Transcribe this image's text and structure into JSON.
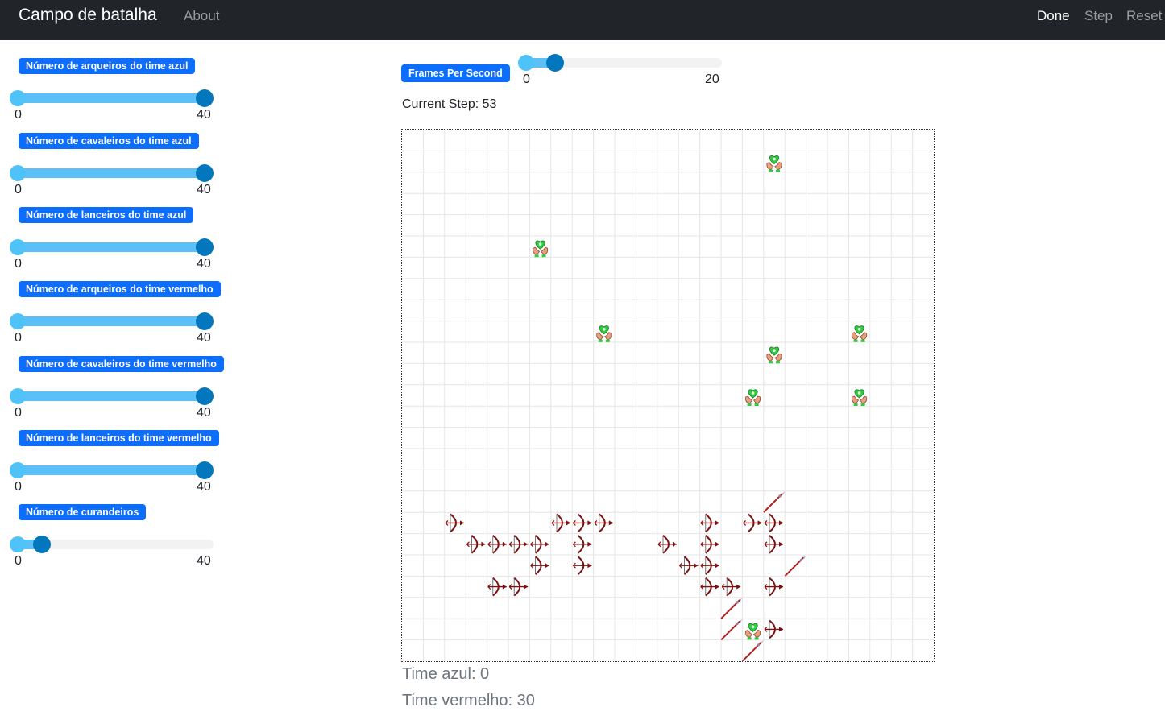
{
  "navbar": {
    "brand": "Campo de batalha",
    "about": "About",
    "done": "Done",
    "step": "Step",
    "reset": "Reset"
  },
  "params": [
    {
      "label": "Número de arqueiros do time azul",
      "min": "0",
      "max": "40",
      "value": 40
    },
    {
      "label": "Número de cavaleiros do time azul",
      "min": "0",
      "max": "40",
      "value": 40
    },
    {
      "label": "Número de lanceiros do time azul",
      "min": "0",
      "max": "40",
      "value": 40
    },
    {
      "label": "Número de arqueiros do time vermelho",
      "min": "0",
      "max": "40",
      "value": 40
    },
    {
      "label": "Número de cavaleiros do time vermelho",
      "min": "0",
      "max": "40",
      "value": 40
    },
    {
      "label": "Número de lanceiros do time vermelho",
      "min": "0",
      "max": "40",
      "value": 40
    },
    {
      "label": "Número de curandeiros",
      "min": "0",
      "max": "40",
      "value": 5
    }
  ],
  "fps": {
    "label": "Frames Per Second",
    "min": "0",
    "max": "20",
    "value": 3
  },
  "current_step": "Current Step: 53",
  "scores": {
    "blue": "Time azul: 0",
    "red": "Time vermelho: 30"
  },
  "grid": {
    "columns": 25,
    "rows": 25,
    "healer_icon": "healer-icon",
    "archer_icon": "red-archer-icon",
    "lancer_icon": "red-lancer-icon",
    "agents": [
      {
        "type": "healer",
        "col": 17,
        "row": 1
      },
      {
        "type": "healer",
        "col": 6,
        "row": 5
      },
      {
        "type": "healer",
        "col": 9,
        "row": 9
      },
      {
        "type": "healer",
        "col": 17,
        "row": 10
      },
      {
        "type": "healer",
        "col": 21,
        "row": 9
      },
      {
        "type": "healer",
        "col": 16,
        "row": 12
      },
      {
        "type": "healer",
        "col": 21,
        "row": 12
      },
      {
        "type": "healer",
        "col": 16,
        "row": 23
      },
      {
        "type": "archer",
        "col": 2,
        "row": 18
      },
      {
        "type": "archer",
        "col": 3,
        "row": 19
      },
      {
        "type": "archer",
        "col": 4,
        "row": 19
      },
      {
        "type": "archer",
        "col": 5,
        "row": 19
      },
      {
        "type": "archer",
        "col": 6,
        "row": 19
      },
      {
        "type": "archer",
        "col": 7,
        "row": 18
      },
      {
        "type": "archer",
        "col": 8,
        "row": 18
      },
      {
        "type": "archer",
        "col": 9,
        "row": 18
      },
      {
        "type": "archer",
        "col": 8,
        "row": 19
      },
      {
        "type": "archer",
        "col": 6,
        "row": 20
      },
      {
        "type": "archer",
        "col": 8,
        "row": 20
      },
      {
        "type": "archer",
        "col": 4,
        "row": 21
      },
      {
        "type": "archer",
        "col": 5,
        "row": 21
      },
      {
        "type": "archer",
        "col": 12,
        "row": 19
      },
      {
        "type": "archer",
        "col": 14,
        "row": 18
      },
      {
        "type": "archer",
        "col": 14,
        "row": 19
      },
      {
        "type": "archer",
        "col": 13,
        "row": 20
      },
      {
        "type": "archer",
        "col": 14,
        "row": 20
      },
      {
        "type": "archer",
        "col": 14,
        "row": 21
      },
      {
        "type": "archer",
        "col": 15,
        "row": 21
      },
      {
        "type": "archer",
        "col": 16,
        "row": 18
      },
      {
        "type": "archer",
        "col": 17,
        "row": 18
      },
      {
        "type": "archer",
        "col": 17,
        "row": 19
      },
      {
        "type": "archer",
        "col": 17,
        "row": 21
      },
      {
        "type": "archer",
        "col": 17,
        "row": 23
      },
      {
        "type": "lancer",
        "col": 17,
        "row": 17
      },
      {
        "type": "lancer",
        "col": 18,
        "row": 20
      },
      {
        "type": "lancer",
        "col": 15,
        "row": 22
      },
      {
        "type": "lancer",
        "col": 15,
        "row": 23
      },
      {
        "type": "lancer",
        "col": 16,
        "row": 24
      }
    ]
  }
}
